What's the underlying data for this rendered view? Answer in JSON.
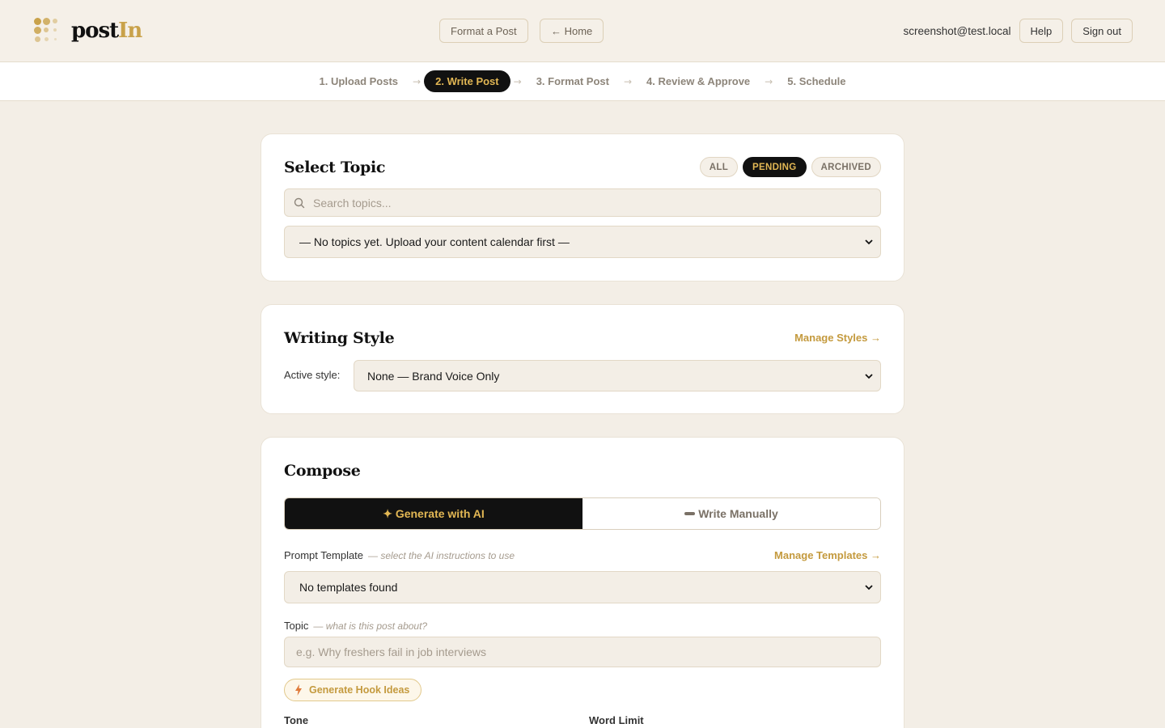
{
  "header": {
    "logo_text_main": "post",
    "logo_text_accent": "In",
    "format_btn": "Format a Post",
    "home_btn": "← Home",
    "user_email": "screenshot@test.local",
    "help_btn": "Help",
    "signout_btn": "Sign out"
  },
  "stepper": {
    "steps": [
      {
        "label": "1. Upload Posts"
      },
      {
        "label": "2. Write Post",
        "active": true
      },
      {
        "label": "3. Format Post"
      },
      {
        "label": "4. Review & Approve"
      },
      {
        "label": "5. Schedule"
      }
    ],
    "arrow": "→"
  },
  "select_topic": {
    "title": "Select Topic",
    "filters": [
      {
        "label": "ALL"
      },
      {
        "label": "PENDING",
        "active": true
      },
      {
        "label": "ARCHIVED"
      }
    ],
    "search_placeholder": "Search topics...",
    "select_value": "— No topics yet. Upload your content calendar first —"
  },
  "writing_style": {
    "title": "Writing Style",
    "manage_link": "Manage Styles →",
    "active_label": "Active style:",
    "select_value": "None — Brand Voice Only"
  },
  "compose": {
    "title": "Compose",
    "mode_ai": "✦ Generate with AI",
    "mode_manual": "Write Manually",
    "prompt_label": "Prompt Template",
    "prompt_hint": "— select the AI instructions to use",
    "manage_templates": "Manage Templates →",
    "template_value": "No templates found",
    "topic_label": "Topic",
    "topic_hint": "— what is this post about?",
    "topic_placeholder": "e.g. Why freshers fail in job interviews",
    "hook_btn": "Generate Hook Ideas",
    "tone_label": "Tone",
    "word_limit_label": "Word Limit"
  },
  "colors": {
    "accent_gold": "#c9a24a",
    "dark": "#111111",
    "background": "#f3eee6"
  }
}
